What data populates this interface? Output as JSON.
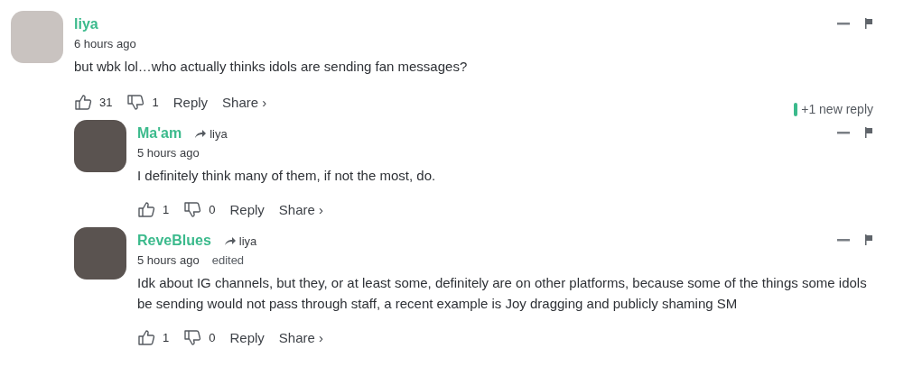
{
  "comments": [
    {
      "author": "liya",
      "time": "6 hours ago",
      "text": "but wbk lol…who actually thinks idols are sending fan messages?",
      "likes": "31",
      "dislikes": "1",
      "reply": "Reply",
      "share": "Share ›",
      "new_replies": "+1 new reply",
      "children": [
        {
          "author": "Ma'am",
          "reply_to": "liya",
          "time": "5 hours ago",
          "text": "I definitely think many of them, if not the most, do.",
          "likes": "1",
          "dislikes": "0",
          "reply": "Reply",
          "share": "Share ›"
        },
        {
          "author": "ReveBlues",
          "reply_to": "liya",
          "time": "5 hours ago",
          "edited": "edited",
          "text": "Idk about IG channels, but they, or at least some, definitely are on other platforms, because some of the things some idols be sending would not pass through staff, a recent example is Joy dragging and publicly shaming SM",
          "likes": "1",
          "dislikes": "0",
          "reply": "Reply",
          "share": "Share ›"
        }
      ]
    }
  ]
}
